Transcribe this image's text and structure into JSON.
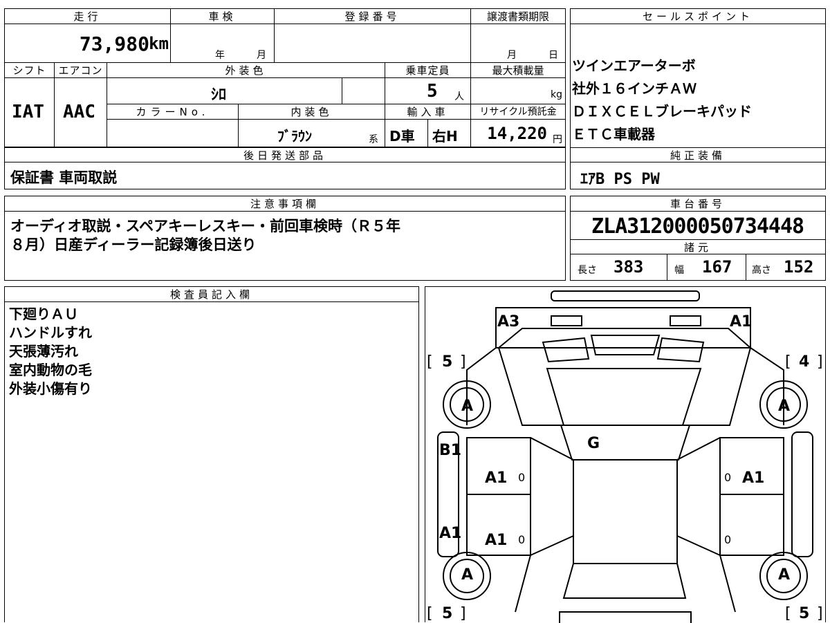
{
  "top": {
    "mileage_label": "走行",
    "mileage": "73,980",
    "mileage_unit": "km",
    "shaken_label": "車検",
    "shaken_year": "年",
    "shaken_month": "月",
    "reg_label": "登録番号",
    "transfer_label": "譲渡書類期限",
    "transfer_month": "月",
    "transfer_day": "日",
    "shift_label": "シフト",
    "shift": "IAT",
    "ac_label": "エアコン",
    "ac": "AAC",
    "ext_color_label": "外装色",
    "ext_color": "ｼﾛ",
    "capacity_label": "乗車定員",
    "capacity": "5",
    "capacity_unit": "人",
    "max_load_label": "最大積載量",
    "max_load_unit": "kg",
    "color_no_label": "カラーNo.",
    "int_color_label": "内装色",
    "int_color": "ﾌﾞﾗｳﾝ",
    "int_color_suffix": "系",
    "import_label": "輸入車",
    "import_type": "D車",
    "handle": "右H",
    "recycle_label": "リサイクル預託金",
    "recycle": "14,220",
    "recycle_unit": "円",
    "later_label": "後日発送部品",
    "later_items": "保証書 車両取説"
  },
  "sales": {
    "label": "セールスポイント",
    "lines": [
      "ツインエアーターボ",
      "社外１６インチＡＷ",
      "ＤＩＸＣＥＬブレーキパッド",
      "ＥＴＣ車載器"
    ],
    "equip_label": "純正装備",
    "equip": "ｴｱB PS PW"
  },
  "notes": {
    "label": "注意事項欄",
    "line1": "オーディオ取説・スペアキーレスキー・前回車検時（Ｒ５年",
    "line2": "８月）日産ディーラー記録簿後日送り"
  },
  "chassis": {
    "label": "車台番号",
    "number": "ZLA312000050734448",
    "specs_label": "諸元",
    "length_label": "長さ",
    "length": "383",
    "width_label": "幅",
    "width": "167",
    "height_label": "高さ",
    "height": "152"
  },
  "inspector": {
    "label": "検査員記入欄",
    "lines": [
      "下廻りＡＵ",
      "ハンドルすれ",
      "天張薄汚れ",
      "室内動物の毛",
      "外装小傷有り"
    ]
  },
  "diagram": {
    "marks": {
      "front_left": "A3",
      "front_right": "A1",
      "tread_fl": "5",
      "tread_fr": "4",
      "tread_rl": "5",
      "tread_rr": "5",
      "wheel_fl": "A",
      "wheel_fr": "A",
      "wheel_rl": "A",
      "wheel_rr": "A",
      "glass": "G",
      "sill_left_front": "B1",
      "sill_left_rear": "A1",
      "door_lf": "A1",
      "door_lr": "A1",
      "door_rf": "A1",
      "zero": "0"
    }
  }
}
